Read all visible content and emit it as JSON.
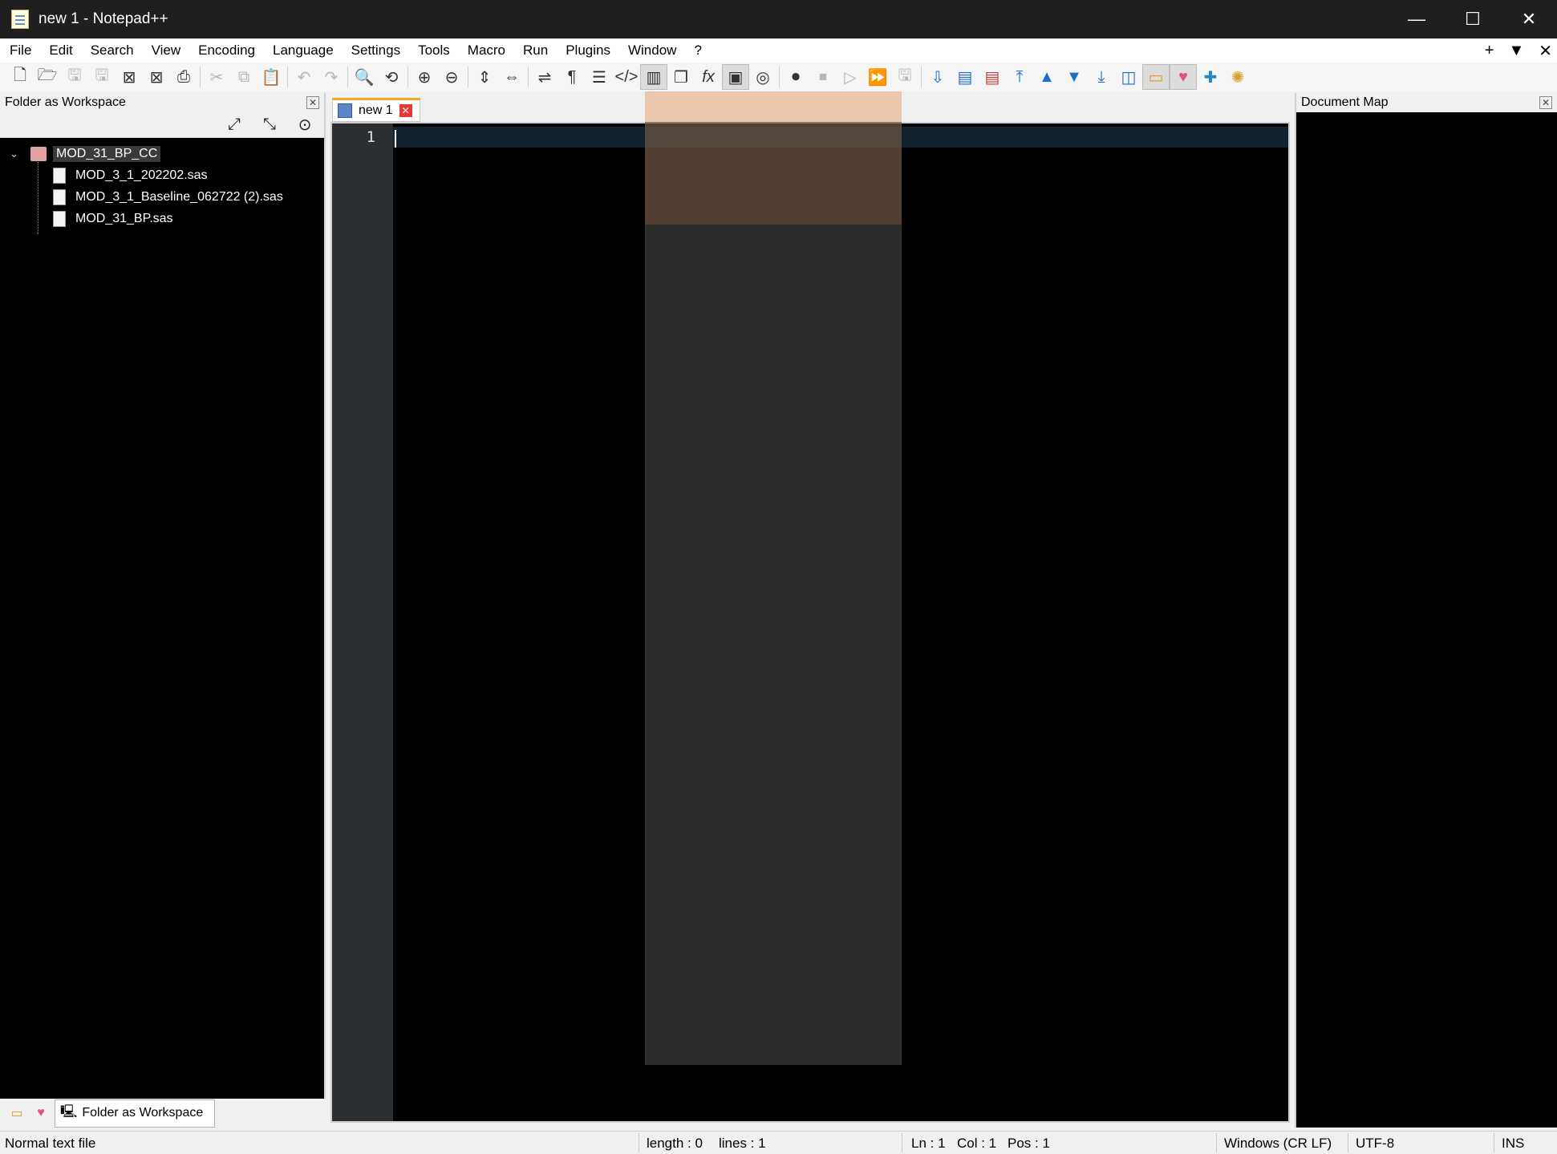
{
  "window": {
    "title": "new 1 - Notepad++",
    "controls": {
      "minimize": "—",
      "maximize": "☐",
      "close": "✕"
    }
  },
  "menu": {
    "items": [
      "File",
      "Edit",
      "Search",
      "View",
      "Encoding",
      "Language",
      "Settings",
      "Tools",
      "Macro",
      "Run",
      "Plugins",
      "Window",
      "?"
    ],
    "right": {
      "add": "+",
      "dropdown": "▼",
      "close": "✕"
    }
  },
  "toolbar": {
    "icons": [
      "new-file-icon",
      "open-file-icon",
      "save-icon",
      "save-all-icon",
      "close-icon",
      "close-all-icon",
      "print-icon",
      "cut-icon",
      "copy-icon",
      "paste-icon",
      "undo-icon",
      "redo-icon",
      "find-icon",
      "replace-icon",
      "zoom-in-icon",
      "zoom-out-icon",
      "sync-vertical-icon",
      "sync-horizontal-icon",
      "word-wrap-icon",
      "show-all-chars-icon",
      "indent-guide-icon",
      "xml-tag-icon",
      "document-map-icon",
      "document-list-icon",
      "function-list-icon",
      "folder-workspace-icon",
      "monitoring-icon",
      "record-macro-icon",
      "stop-record-icon",
      "playback-icon",
      "run-macro-multiple-icon",
      "save-macro-icon"
    ]
  },
  "left_panel": {
    "title": "Folder as Workspace",
    "tree": {
      "root": "MOD_31_BP_CC",
      "files": [
        "MOD_3_1_202202.sas",
        "MOD_3_1_Baseline_062722 (2).sas",
        "MOD_31_BP.sas"
      ]
    },
    "tabs": {
      "active_label": "Folder as Workspace"
    }
  },
  "editor": {
    "tab_label": "new 1",
    "line_numbers": [
      "1"
    ]
  },
  "doc_map": {
    "title": "Document Map"
  },
  "status": {
    "file_type": "Normal text file",
    "length": "length : 0",
    "lines": "lines : 1",
    "ln": "Ln : 1",
    "col": "Col : 1",
    "pos": "Pos : 1",
    "eol": "Windows (CR LF)",
    "encoding": "UTF-8",
    "mode": "INS"
  }
}
